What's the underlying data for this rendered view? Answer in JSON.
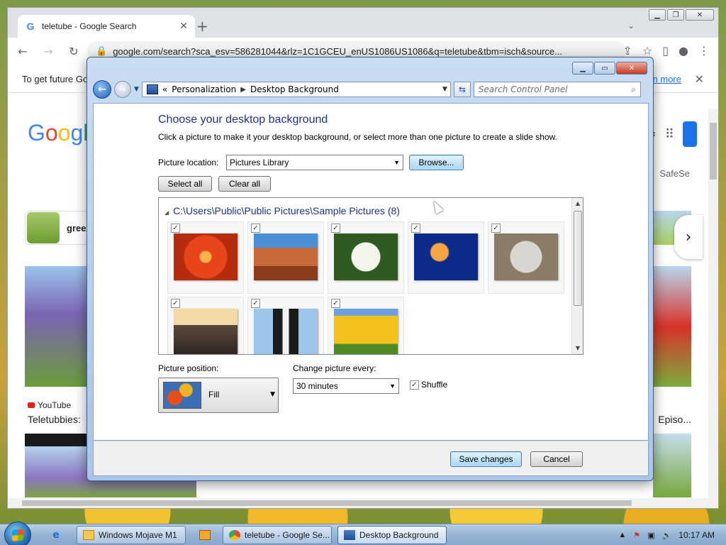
{
  "browser": {
    "tab_title": "teletube - Google Search",
    "url": "google.com/search?sca_esv=586281044&rlz=1C1GCEU_enUS1086US1086&q=teletube&tbm=isch&source...",
    "infobar_text": "To get future Go",
    "infobar_link": "rn more",
    "logo_letters": [
      "G",
      "o",
      "o",
      "g",
      "l"
    ],
    "safesearch": "SafeSe",
    "chip_label": "gree",
    "result_source": "YouTube",
    "result_title": "Teletubbies: ",
    "right_result_title": "Episo..."
  },
  "window": {
    "breadcrumb": [
      "Personalization",
      "Desktop Background"
    ],
    "search_placeholder": "Search Control Panel",
    "heading": "Choose your desktop background",
    "subheading": "Click a picture to make it your desktop background, or select more than one picture to create a slide show.",
    "picture_location_label": "Picture location:",
    "picture_location_value": "Pictures Library",
    "browse_label": "Browse...",
    "select_all_label": "Select all",
    "clear_all_label": "Clear all",
    "gallery_group": "C:\\Users\\Public\\Public Pictures\\Sample Pictures (8)",
    "pictures": [
      {
        "name": "chrysanthemum",
        "checked": true
      },
      {
        "name": "desert",
        "checked": true
      },
      {
        "name": "hydrangeas",
        "checked": true
      },
      {
        "name": "jellyfish",
        "checked": true
      },
      {
        "name": "koala",
        "checked": true
      },
      {
        "name": "lighthouse",
        "checked": true
      },
      {
        "name": "penguins",
        "checked": true
      },
      {
        "name": "tulips",
        "checked": true
      }
    ],
    "picture_position_label": "Picture position:",
    "picture_position_value": "Fill",
    "change_every_label": "Change picture every:",
    "change_every_value": "30 minutes",
    "shuffle_label": "Shuffle",
    "shuffle_checked": true,
    "save_label": "Save changes",
    "cancel_label": "Cancel"
  },
  "taskbar": {
    "tasks": [
      "Windows Mojave M1",
      "teletube - Google Se...",
      "Desktop Background"
    ],
    "clock": "10:17 AM"
  }
}
